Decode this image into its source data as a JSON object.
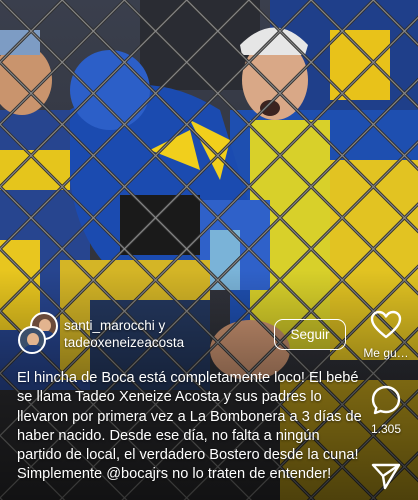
{
  "post": {
    "authors_line1": "santi_marocchi y",
    "authors_line2": "tadeoxeneizeacosta",
    "follow_label": "Seguir",
    "caption": "El hincha de Boca está completamente loco! El bebé se llama Tadeo Xeneize Acosta y sus padres lo llevaron por primera vez a La Bombonera a 3 días de haber nacido. Desde ese día, no falta a ningún partido de local, el verdadero Bostero desde la cuna! Simplemente @bocajrs no lo traten de entender!"
  },
  "actions": {
    "like_label": "Me gu…",
    "comment_count": "1.305"
  },
  "icons": {
    "like": "heart-icon",
    "comment": "comment-bubble-icon",
    "share": "send-icon"
  },
  "colors": {
    "boca_blue": "#1c3f8f",
    "boca_yellow": "#f2c70f",
    "text": "#ffffff"
  }
}
